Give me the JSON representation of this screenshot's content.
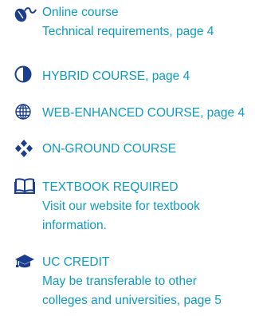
{
  "colors": {
    "text": "#0f9bbf",
    "icon": "#1a3d8f"
  },
  "items": [
    {
      "icon": "mouse-icon",
      "lines": [
        "Online course",
        "Technical requirements, page 4"
      ]
    },
    {
      "icon": "half-circle-icon",
      "lines": [
        "HYBRID COURSE, page 4"
      ]
    },
    {
      "icon": "globe-icon",
      "lines": [
        "WEB-ENHANCED COURSE, page 4"
      ]
    },
    {
      "icon": "four-diamonds-icon",
      "lines": [
        "ON-GROUND COURSE"
      ]
    },
    {
      "icon": "open-book-icon",
      "lines": [
        "TEXTBOOK REQUIRED",
        "Visit our website for textbook",
        "information."
      ]
    },
    {
      "icon": "graduation-cap-icon",
      "lines": [
        "UC CREDIT",
        "May be transferable to other",
        "colleges and universities, page 5"
      ]
    }
  ]
}
